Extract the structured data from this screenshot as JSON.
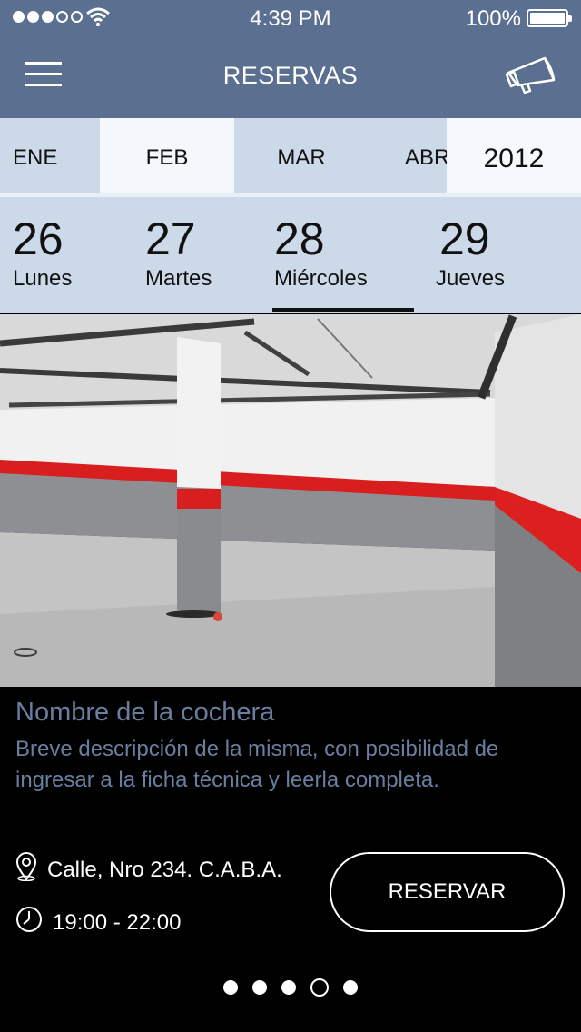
{
  "status_bar": {
    "time": "4:39 PM",
    "battery": "100%",
    "signal_dots_filled": 3,
    "signal_dots_total": 5
  },
  "header": {
    "title": "RESERVAS",
    "menu_icon": "hamburger-menu-icon",
    "action_icon": "megaphone-icon",
    "background_color": "#5b7090"
  },
  "months": {
    "items": [
      "ENE",
      "FEB",
      "MAR",
      "ABR"
    ],
    "selected": "FEB",
    "year": "2012"
  },
  "days": {
    "items": [
      {
        "number": "26",
        "name": "Lunes"
      },
      {
        "number": "27",
        "name": "Martes"
      },
      {
        "number": "28",
        "name": "Miércoles"
      },
      {
        "number": "29",
        "name": "Jueves"
      }
    ],
    "selected": "28"
  },
  "listing": {
    "name": "Nombre de la cochera",
    "description": "Breve descripción de la misma, con posibilidad de ingresar a la ficha técnica y leerla completa.",
    "address": "Calle, Nro 234. C.A.B.A.",
    "hours": "19:00 - 22:00",
    "reserve_label": "RESERVAR",
    "text_color": "#6a7fa0"
  },
  "pager": {
    "total": 5,
    "active_index": 3
  }
}
